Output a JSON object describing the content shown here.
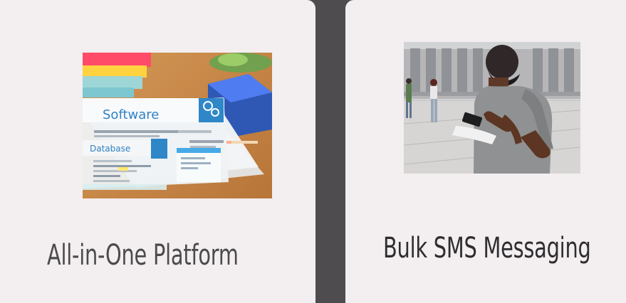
{
  "cards": [
    {
      "title": "All-in-One Platform",
      "image": {
        "headline": "Software",
        "subheadline": "Database"
      }
    },
    {
      "title": "Bulk SMS Messaging"
    }
  ],
  "colors": {
    "page_background": "#4f4c4f",
    "card_background": "#f3eef0",
    "left_title": "#4b4a4c",
    "right_title": "#2e2d30"
  }
}
